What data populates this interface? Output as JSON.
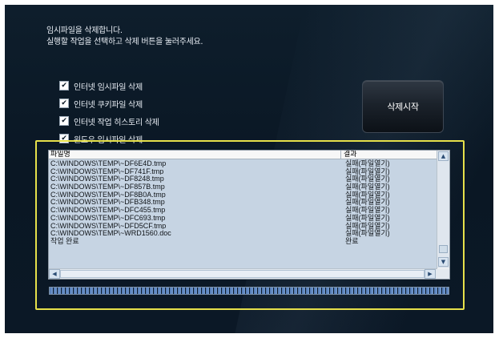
{
  "intro": {
    "line1": "임시파일을 삭제합니다.",
    "line2": "실행할 작업을 선택하고 삭제 버튼을 눌러주세요."
  },
  "options": [
    {
      "label": "인터넷 임시파일 삭제",
      "checked": true
    },
    {
      "label": "인터넷 쿠키파일 삭제",
      "checked": true
    },
    {
      "label": "인터넷 작업 히스토리 삭제",
      "checked": true
    },
    {
      "label": "윈도우 임시파일 삭제",
      "checked": true
    }
  ],
  "start_button": {
    "label": "삭제시작"
  },
  "list": {
    "col_file": "파일명",
    "col_result": "결과",
    "rows": [
      {
        "file": "C:\\WINDOWS\\TEMP\\~DF6E4D.tmp",
        "result": "실패(파일열기)"
      },
      {
        "file": "C:\\WINDOWS\\TEMP\\~DF741F.tmp",
        "result": "실패(파일열기)"
      },
      {
        "file": "C:\\WINDOWS\\TEMP\\~DF8248.tmp",
        "result": "실패(파일열기)"
      },
      {
        "file": "C:\\WINDOWS\\TEMP\\~DF857B.tmp",
        "result": "실패(파일열기)"
      },
      {
        "file": "C:\\WINDOWS\\TEMP\\~DF8B0A.tmp",
        "result": "실패(파일열기)"
      },
      {
        "file": "C:\\WINDOWS\\TEMP\\~DFB348.tmp",
        "result": "실패(파일열기)"
      },
      {
        "file": "C:\\WINDOWS\\TEMP\\~DFC455.tmp",
        "result": "실패(파일열기)"
      },
      {
        "file": "C:\\WINDOWS\\TEMP\\~DFC693.tmp",
        "result": "실패(파일열기)"
      },
      {
        "file": "C:\\WINDOWS\\TEMP\\~DFD5CF.tmp",
        "result": "실패(파일열기)"
      },
      {
        "file": "C:\\WINDOWS\\TEMP\\~WRD1560.doc",
        "result": "실패(파일열기)"
      },
      {
        "file": "작업 완료",
        "result": "완료"
      }
    ]
  },
  "progress": {
    "value": 1.0
  },
  "colors": {
    "panel_border": "#e6e04a",
    "list_bg": "#c6d4e3",
    "progress_fill": "#6d95cc"
  }
}
